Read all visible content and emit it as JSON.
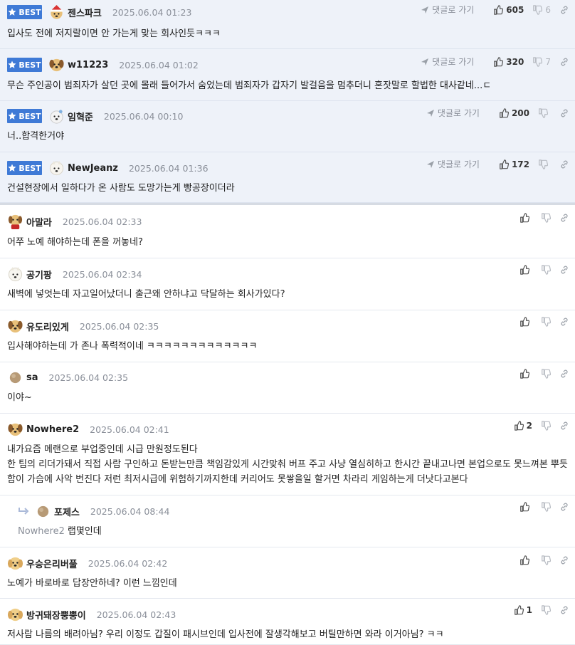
{
  "labels": {
    "best": "BEST",
    "goto": "댓글로 가기"
  },
  "best_comments": [
    {
      "nick": "젠스파크",
      "date": "2025.06.04 01:23",
      "body": "입사도 전에 저지랄이면 안 가는게 맞는 회사인듯ㅋㅋㅋ",
      "likes": "605",
      "dislikes": "6",
      "avatar": "santa-dog"
    },
    {
      "nick": "w11223",
      "date": "2025.06.04 01:02",
      "body": "무슨 주인공이 범죄자가 살던 곳에 몰래 들어가서 숨었는데 범죄자가 갑자기 발걸음을 멈추더니 혼잣말로 할법한 대사같네...ㄷ",
      "likes": "320",
      "dislikes": "7",
      "avatar": "puppy"
    },
    {
      "nick": "임혁준",
      "date": "2025.06.04 00:10",
      "body": "너..합격한거야",
      "likes": "200",
      "dislikes": "",
      "avatar": "white-dog"
    },
    {
      "nick": "NewJeanz",
      "date": "2025.06.04 01:36",
      "body": "건설현장에서 일하다가 온 사람도 도망가는게 빵공장이더라",
      "likes": "172",
      "dislikes": "",
      "avatar": "samoyed"
    }
  ],
  "comments": [
    {
      "nick": "아말라",
      "date": "2025.06.04 02:33",
      "body": "어쭈 노예 해야하는데 폰을 꺼놓네?",
      "likes": "",
      "avatar": "red-dog"
    },
    {
      "nick": "공기팡",
      "date": "2025.06.04 02:34",
      "body": "새벽에 넣엇는데 자고일어났더니 출근왜 안하냐고 닥달하는 회사가있다?",
      "likes": "",
      "avatar": "samoyed"
    },
    {
      "nick": "유도리있게",
      "date": "2025.06.04 02:35",
      "body": "입사해야하는데 가 존나 폭력적이네 ㅋㅋㅋㅋㅋㅋㅋㅋㅋㅋㅋㅋㅋ",
      "likes": "",
      "avatar": "puppy"
    },
    {
      "nick": "sa",
      "date": "2025.06.04 02:35",
      "body": "이야~",
      "likes": "",
      "avatar": "ball"
    },
    {
      "nick": "Nowhere2",
      "date": "2025.06.04 02:41",
      "body": "내가요즘 메랜으로 부업중인데 시급 만원정도된다\n한 팀의 리더가돼서 직접 사람 구인하고 돈받는만큼 책임감있게 시간맞춰 버프 주고 사냥 열심히하고 한시간 끝내고나면 본업으로도 못느껴본 뿌듯함이 가슴에 사악 번진다 저런 최저시급에 위험하기까지한데 커리어도 못쌓을일 할거면 차라리 게임하는게 더낫다고본다",
      "likes": "2",
      "avatar": "puppy"
    },
    {
      "nick": "포제스",
      "date": "2025.06.04 08:44",
      "body": "랩몇인데",
      "mention": "Nowhere2",
      "likes": "",
      "avatar": "ball",
      "reply": true
    },
    {
      "nick": "우승은리버풀",
      "date": "2025.06.04 02:42",
      "body": "노예가 바로바로 답장안하네? 이런 느낌인데",
      "likes": "",
      "avatar": "retriever"
    },
    {
      "nick": "방귀돼장뿡뿡이",
      "date": "2025.06.04 02:43",
      "body": "저사람 나름의 배려아님? 우리 이정도 갑질이 패시브인데 입사전에 잘생각해보고 버틸만하면 와라 이거아님? ㅋㅋ",
      "likes": "1",
      "avatar": "retriever"
    }
  ]
}
